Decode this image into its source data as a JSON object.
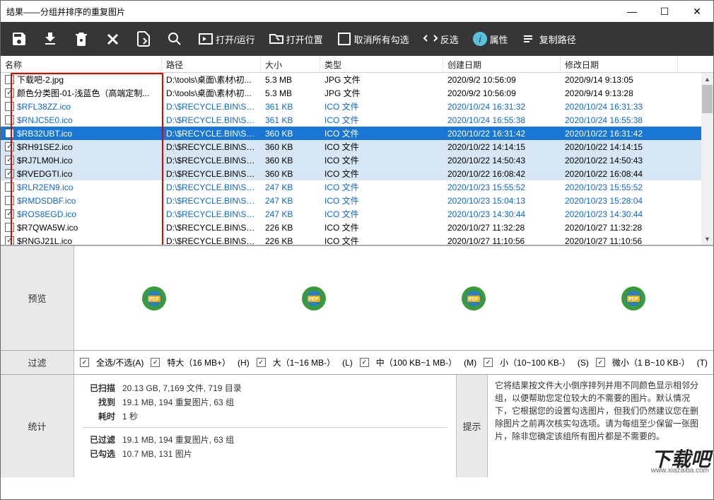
{
  "title": "结果——分组并排序的重复图片",
  "toolbar": {
    "open_run": "打开/运行",
    "open_location": "打开位置",
    "uncheck_all": "取消所有勾选",
    "invert": "反选",
    "properties": "属性",
    "copy_path": "复制路径"
  },
  "columns": {
    "name": "名称",
    "path": "路径",
    "size": "大小",
    "type": "类型",
    "created": "创建日期",
    "modified": "修改日期"
  },
  "rows": [
    {
      "chk": false,
      "name": "下载吧-2.jpg",
      "path": "D:\\tools\\桌面\\素材\\初...",
      "size": "5.3 MB",
      "type": "JPG 文件",
      "cd": "2020/9/2 10:56:09",
      "md": "2020/9/14 9:13:05",
      "style": "black"
    },
    {
      "chk": true,
      "name": "颜色分类图-01-浅蓝色（高端定制...",
      "path": "D:\\tools\\桌面\\素材\\初...",
      "size": "5.3 MB",
      "type": "JPG 文件",
      "cd": "2020/9/2 10:56:09",
      "md": "2020/9/14 9:13:28",
      "style": "black"
    },
    {
      "chk": false,
      "name": "$RFL38ZZ.ico",
      "path": "D:\\$RECYCLE.BIN\\S-1-...",
      "size": "361 KB",
      "type": "ICO 文件",
      "cd": "2020/10/24 16:31:32",
      "md": "2020/10/24 16:31:33",
      "style": "linked"
    },
    {
      "chk": false,
      "name": "$RNJC5E0.ico",
      "path": "D:\\$RECYCLE.BIN\\S-1-...",
      "size": "361 KB",
      "type": "ICO 文件",
      "cd": "2020/10/24 16:55:38",
      "md": "2020/10/24 16:55:38",
      "style": "linked"
    },
    {
      "chk": false,
      "name": "$RB32UBT.ico",
      "path": "D:\\$RECYCLE.BIN\\S-1-...",
      "size": "360 KB",
      "type": "ICO 文件",
      "cd": "2020/10/22 16:31:42",
      "md": "2020/10/22 16:31:42",
      "style": "selected"
    },
    {
      "chk": true,
      "name": "$RH91SE2.ico",
      "path": "D:\\$RECYCLE.BIN\\S-1-...",
      "size": "360 KB",
      "type": "ICO 文件",
      "cd": "2020/10/22 14:14:15",
      "md": "2020/10/22 14:14:15",
      "style": "shade"
    },
    {
      "chk": true,
      "name": "$RJ7LM0H.ico",
      "path": "D:\\$RECYCLE.BIN\\S-1-...",
      "size": "360 KB",
      "type": "ICO 文件",
      "cd": "2020/10/22 14:50:43",
      "md": "2020/10/22 14:50:43",
      "style": "shade"
    },
    {
      "chk": true,
      "name": "$RVEDGTI.ico",
      "path": "D:\\$RECYCLE.BIN\\S-1-...",
      "size": "360 KB",
      "type": "ICO 文件",
      "cd": "2020/10/22 16:08:42",
      "md": "2020/10/22 16:08:44",
      "style": "shade"
    },
    {
      "chk": false,
      "name": "$RLR2EN9.ico",
      "path": "D:\\$RECYCLE.BIN\\S-1-...",
      "size": "247 KB",
      "type": "ICO 文件",
      "cd": "2020/10/23 15:55:52",
      "md": "2020/10/23 15:55:52",
      "style": "linked"
    },
    {
      "chk": false,
      "name": "$RMDSDBF.ico",
      "path": "D:\\$RECYCLE.BIN\\S-1-...",
      "size": "247 KB",
      "type": "ICO 文件",
      "cd": "2020/10/23 15:04:13",
      "md": "2020/10/23 15:28:04",
      "style": "linked"
    },
    {
      "chk": true,
      "name": "$ROS8EGD.ico",
      "path": "D:\\$RECYCLE.BIN\\S-1-...",
      "size": "247 KB",
      "type": "ICO 文件",
      "cd": "2020/10/23 14:30:44",
      "md": "2020/10/23 14:30:44",
      "style": "linked"
    },
    {
      "chk": false,
      "name": "$R7QWA5W.ico",
      "path": "D:\\$RECYCLE.BIN\\S-1-...",
      "size": "226 KB",
      "type": "ICO 文件",
      "cd": "2020/10/27 11:32:28",
      "md": "2020/10/27 11:32:28",
      "style": "black"
    },
    {
      "chk": true,
      "name": "$RNGJ21L.ico",
      "path": "D:\\$RECYCLE.BIN\\S-1-...",
      "size": "226 KB",
      "type": "ICO 文件",
      "cd": "2020/10/27 11:10:56",
      "md": "2020/10/27 11:10:56",
      "style": "black"
    }
  ],
  "preview": {
    "label": "预览"
  },
  "filter": {
    "label": "过滤",
    "all": "全选/不选(A)",
    "xl": "特大（16 MB+）",
    "xl_key": "(H)",
    "l": "大（1~16 MB-）",
    "l_key": "(L)",
    "m": "中（100 KB~1 MB-）",
    "m_key": "(M)",
    "s": "小（10~100 KB-）",
    "s_key": "(S)",
    "xs": "微小（1 B~10 KB-）",
    "xs_key": "(T)"
  },
  "stats": {
    "label": "统计",
    "scanned_label": "已扫描",
    "scanned": "20.13 GB, 7,169 文件, 719 目录",
    "found_label": "找到",
    "found": "19.1 MB, 194 重复图片, 63 组",
    "time_label": "耗时",
    "time": "1 秒",
    "filtered_label": "已过滤",
    "filtered": "19.1 MB, 194 重复图片, 63 组",
    "checked_label": "已勾选",
    "checked": "10.7 MB, 131 图片"
  },
  "hint": {
    "label": "提示",
    "body": "它将结果按文件大小倒序排列并用不同颜色显示相邻分组，以便帮助您定位较大的不需要的图片。默认情况下，它根据您的设置勾选图片，但我们仍然建议您在删除图片之前再次核实勾选项。请为每组至少保留一张图片，除非您确定该组所有图片都是不需要的。"
  },
  "watermark": "下载吧",
  "watermark_url": "www.xiazaiba.com"
}
